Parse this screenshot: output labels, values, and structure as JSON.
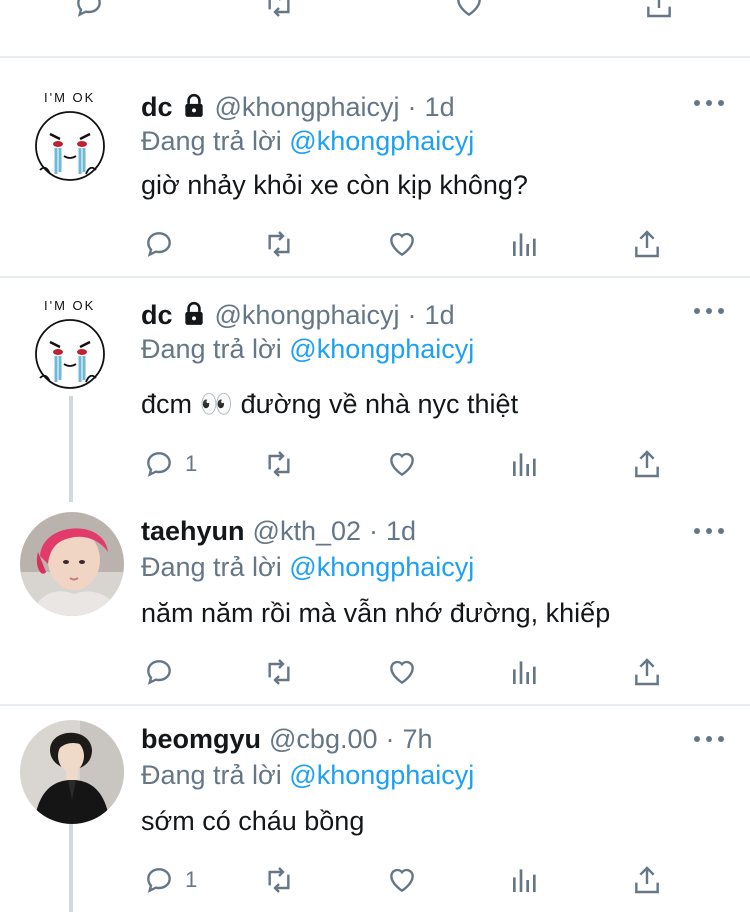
{
  "tweets": [
    {
      "name": "dc",
      "handle": "@khongphaicyj",
      "time": "1d",
      "replying_prefix": "Đang trả lời",
      "replying_to": "@khongphaicyj",
      "text": "giờ nhảy khỏi xe còn kịp không?",
      "reply_count": "",
      "protected": true,
      "avatar": "im-ok-sticker",
      "avatar_text": "I'M OK"
    },
    {
      "name": "dc",
      "handle": "@khongphaicyj",
      "time": "1d",
      "replying_prefix": "Đang trả lời",
      "replying_to": "@khongphaicyj",
      "text": "đcm 👀  đường về nhà nyc thiệt",
      "reply_count": "1",
      "protected": true,
      "avatar": "im-ok-sticker",
      "avatar_text": "I'M OK"
    },
    {
      "name": "taehyun",
      "handle": "@kth_02",
      "time": "1d",
      "replying_prefix": "Đang trả lời",
      "replying_to": "@khongphaicyj",
      "text": "năm năm rồi mà vẫn nhớ đường, khiếp",
      "reply_count": "",
      "protected": false,
      "avatar": "pink-hair-photo"
    },
    {
      "name": "beomgyu",
      "handle": "@cbg.00",
      "time": "7h",
      "replying_prefix": "Đang trả lời",
      "replying_to": "@khongphaicyj",
      "text": "sớm có cháu bồng",
      "reply_count": "1",
      "protected": false,
      "avatar": "black-suit-photo"
    }
  ],
  "separator": "·",
  "icons": [
    "reply-icon",
    "retweet-icon",
    "like-icon",
    "stats-icon",
    "share-icon",
    "more-icon",
    "lock-icon"
  ],
  "colors": {
    "text": "#14171a",
    "muted": "#657786",
    "link": "#1da1f2",
    "divider": "#e6ecf0"
  }
}
